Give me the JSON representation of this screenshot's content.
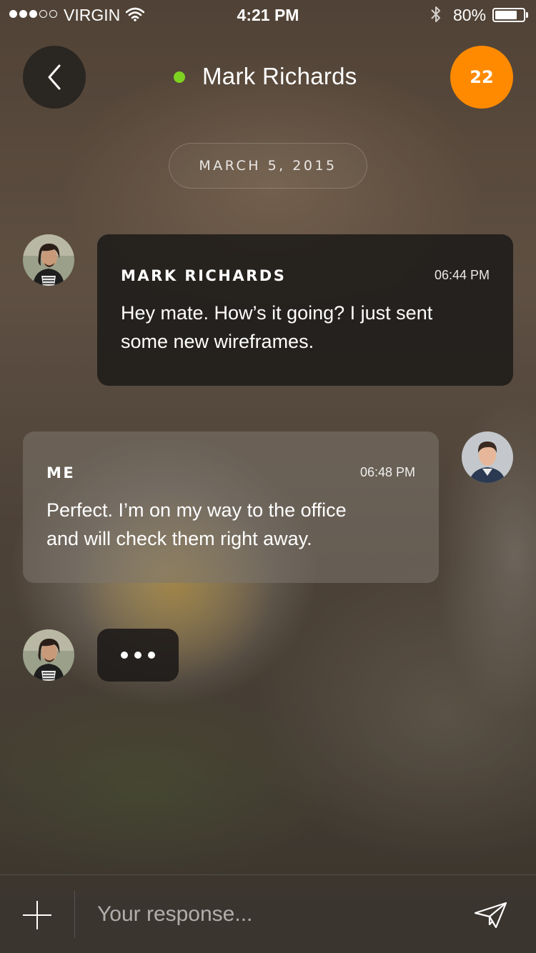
{
  "status_bar": {
    "carrier": "VIRGIN",
    "time": "4:21 PM",
    "battery": "80%",
    "battery_level": 0.8,
    "signal_filled": 3,
    "signal_total": 5
  },
  "header": {
    "contact_name": "Mark Richards",
    "online_status_color": "#7ed321",
    "notification_count": "22",
    "badge_color": "#ff8a00"
  },
  "conversation": {
    "date": "MARCH 5, 2015",
    "messages": [
      {
        "sender": "MARK RICHARDS",
        "time": "06:44 PM",
        "text_line1": "Hey mate. How’s it going? I just sent",
        "text_line2": "some new wireframes."
      },
      {
        "sender": "ME",
        "time": "06:48 PM",
        "text_line1": "Perfect. I’m on my way to the office",
        "text_line2": "and will check them right away."
      }
    ],
    "typing_indicator": "..."
  },
  "composer": {
    "placeholder": "Your response..."
  }
}
